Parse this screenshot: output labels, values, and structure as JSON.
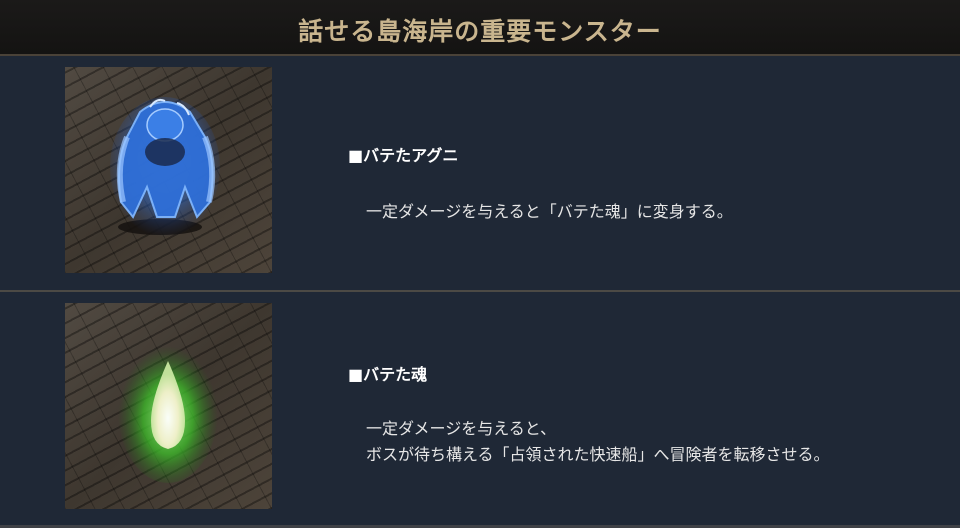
{
  "header": {
    "title": "話せる島海岸の重要モンスター"
  },
  "monsters": [
    {
      "name": "■バテたアグニ",
      "lines": [
        "一定ダメージを与えると「バテた魂」に変身する。"
      ]
    },
    {
      "name": "■バテた魂",
      "lines": [
        "一定ダメージを与えると、",
        "ボスが待ち構える「占領された快速船」へ冒険者を転移させる。"
      ]
    }
  ],
  "colors": {
    "header_bg": "#171615",
    "header_text": "#c9b58e",
    "panel_bg": "#1f2836",
    "divider": "#4c4a45",
    "blue_monster": "#3f7ee0",
    "green_glow": "#52d23a"
  }
}
